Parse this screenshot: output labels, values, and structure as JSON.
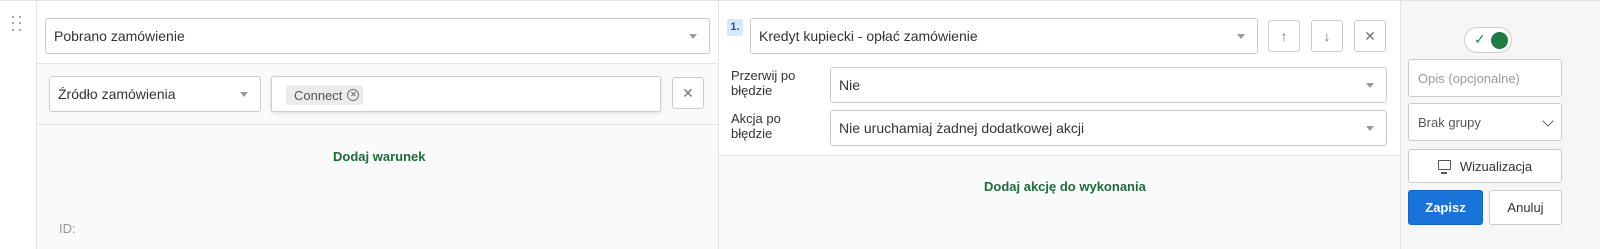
{
  "trigger": {
    "selected": "Pobrano zamówienie"
  },
  "condition": {
    "field_selected": "Źródło zamówienia",
    "tags": [
      "Connect"
    ],
    "remove_icon": "close-icon",
    "add_label": "Dodaj warunek",
    "id_label": "ID:"
  },
  "action": {
    "step_number": "1.",
    "selected": "Kredyt kupiecki - opłać zamówienie",
    "move_up_icon": "arrow-up-icon",
    "move_down_icon": "arrow-down-icon",
    "remove_icon": "close-icon",
    "break_on_error_label": "Przerwij po błędzie",
    "break_on_error_value": "Nie",
    "on_error_action_label": "Akcja po błędzie",
    "on_error_action_value": "Nie uruchamiaj żadnej dodatkowej akcji",
    "add_label": "Dodaj akcję do wykonania"
  },
  "side": {
    "toggle_on": true,
    "description_placeholder": "Opis (opcjonalne)",
    "group_selected": "Brak grupy",
    "visualize_label": "Wizualizacja",
    "save_label": "Zapisz",
    "cancel_label": "Anuluj"
  },
  "colors": {
    "accent_green": "#1e6b3a",
    "primary_blue": "#1a73d9",
    "step_badge_bg": "#d6e8f8"
  }
}
